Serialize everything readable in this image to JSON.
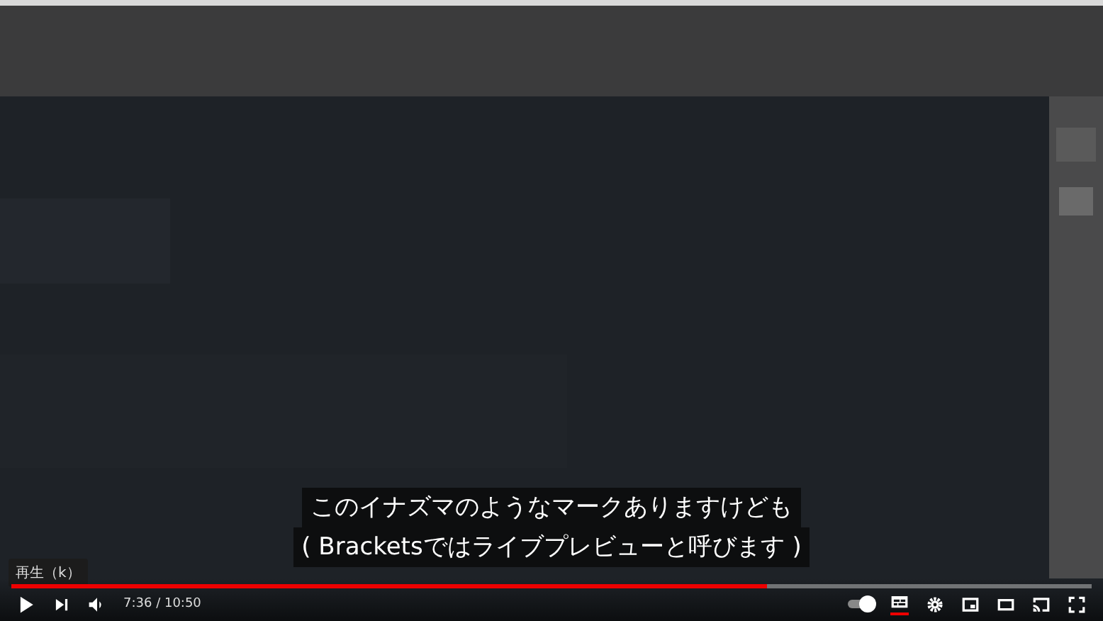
{
  "subtitles": [
    "このイナズマのようなマークありますけども",
    "( Bracketsではライブプレビューと呼びます )"
  ],
  "tooltip": "再生（k）",
  "progress": {
    "level": 0.7
  },
  "time": "7:36 / 10:50",
  "autoplay": {
    "on": true
  },
  "captions": {
    "on": true
  }
}
